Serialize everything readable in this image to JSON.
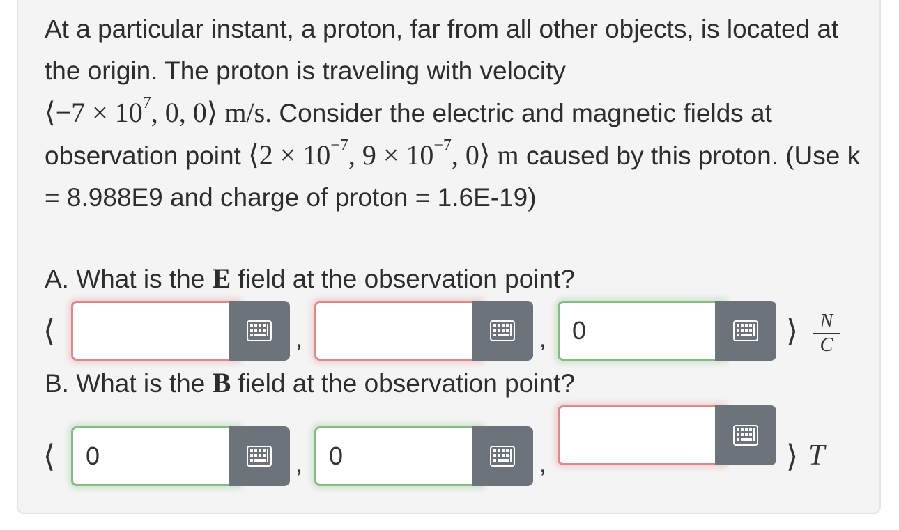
{
  "problem": {
    "intro": "At a particular instant, a proton, far from all other objects, is located at the origin. The proton is traveling with velocity",
    "velocity_vector": "⟨−7 × 10",
    "velocity_exp": "7",
    "velocity_rest": ", 0, 0⟩",
    "velocity_unit": "m/s.",
    "mid_text": "Consider the electric and magnetic fields at observation point",
    "point_vector_a": "⟨2 × 10",
    "point_exp_a": "−7",
    "point_vector_b": ", 9 × 10",
    "point_exp_b": "−7",
    "point_rest": ", 0⟩",
    "point_unit": "m",
    "tail_text": "caused by this proton. (Use k = 8.988E9 and charge of proton = 1.6E-19)"
  },
  "question_a": {
    "prefix": "A. What is the",
    "symbol": "E",
    "suffix": "field at the observation point?",
    "fields": [
      "",
      "",
      "0"
    ],
    "field_status": [
      "incorrect",
      "incorrect",
      "correct"
    ],
    "unit_num": "N",
    "unit_den": "C"
  },
  "question_b": {
    "prefix": "B. What is the",
    "symbol": "B",
    "suffix": "field at the observation point?",
    "fields": [
      "0",
      "0",
      ""
    ],
    "field_status": [
      "correct",
      "correct",
      "incorrect"
    ],
    "unit": "T"
  },
  "brackets": {
    "open": "⟨",
    "close": "⟩",
    "comma": ","
  },
  "icons": {
    "keyboard": "keyboard-icon"
  },
  "colors": {
    "incorrect_border": "#d98b8b",
    "correct_border": "#86bb86",
    "keyboard_button": "#6c737b",
    "card_bg": "#f4f4f4"
  }
}
